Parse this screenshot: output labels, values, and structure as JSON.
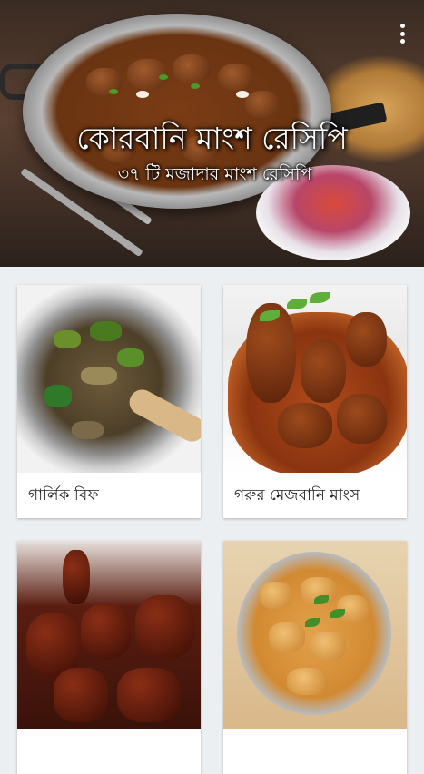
{
  "header": {
    "title": "কোরবানি মাংশ রেসিপি",
    "subtitle": "৩৭ টি মজাদার মাংশ রেসিপি",
    "menu_icon": "more-vert-icon",
    "text_color": "#ffffff"
  },
  "recipes": [
    {
      "label": "গার্লিক বিফ"
    },
    {
      "label": "গরুর মেজবানি মাংস"
    },
    {
      "label": ""
    },
    {
      "label": ""
    }
  ],
  "colors": {
    "background": "#eceff1",
    "card": "#ffffff",
    "label_text": "#212121"
  }
}
